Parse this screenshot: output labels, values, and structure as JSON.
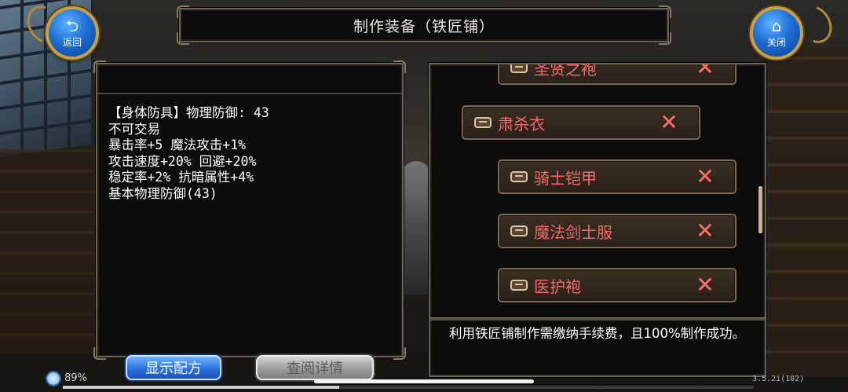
{
  "header": {
    "title": "制作装备（铁匠铺）",
    "back_label": "返回",
    "close_label": "关闭"
  },
  "item_info": {
    "lines": [
      "【身体防具】物理防御: 43",
      "不可交易",
      "暴击率+5 魔法攻击+1%",
      "攻击速度+20% 回避+20%",
      "稳定率+2% 抗暗属性+4%",
      "基本物理防御(43)"
    ]
  },
  "buttons": {
    "show_recipe": "显示配方",
    "view_detail": "查阅详情"
  },
  "recipe_list": {
    "items": [
      {
        "name": "圣贤之袍",
        "selected": false,
        "craftable": false
      },
      {
        "name": "肃杀衣",
        "selected": true,
        "craftable": false
      },
      {
        "name": "骑士铠甲",
        "selected": false,
        "craftable": false
      },
      {
        "name": "魔法剑士服",
        "selected": false,
        "craftable": false
      },
      {
        "name": "医护袍",
        "selected": false,
        "craftable": false
      }
    ],
    "unavailable_mark": "✕",
    "fee_notice": "利用铁匠铺制作需缴纳手续费，且100%制作成功。"
  },
  "status": {
    "battery": "89%",
    "version": "3.5.2i(102)"
  },
  "colors": {
    "item_name_red": "#f26b6b",
    "button_blue": "#2f72e0",
    "frame_gold": "#c9a04a"
  }
}
